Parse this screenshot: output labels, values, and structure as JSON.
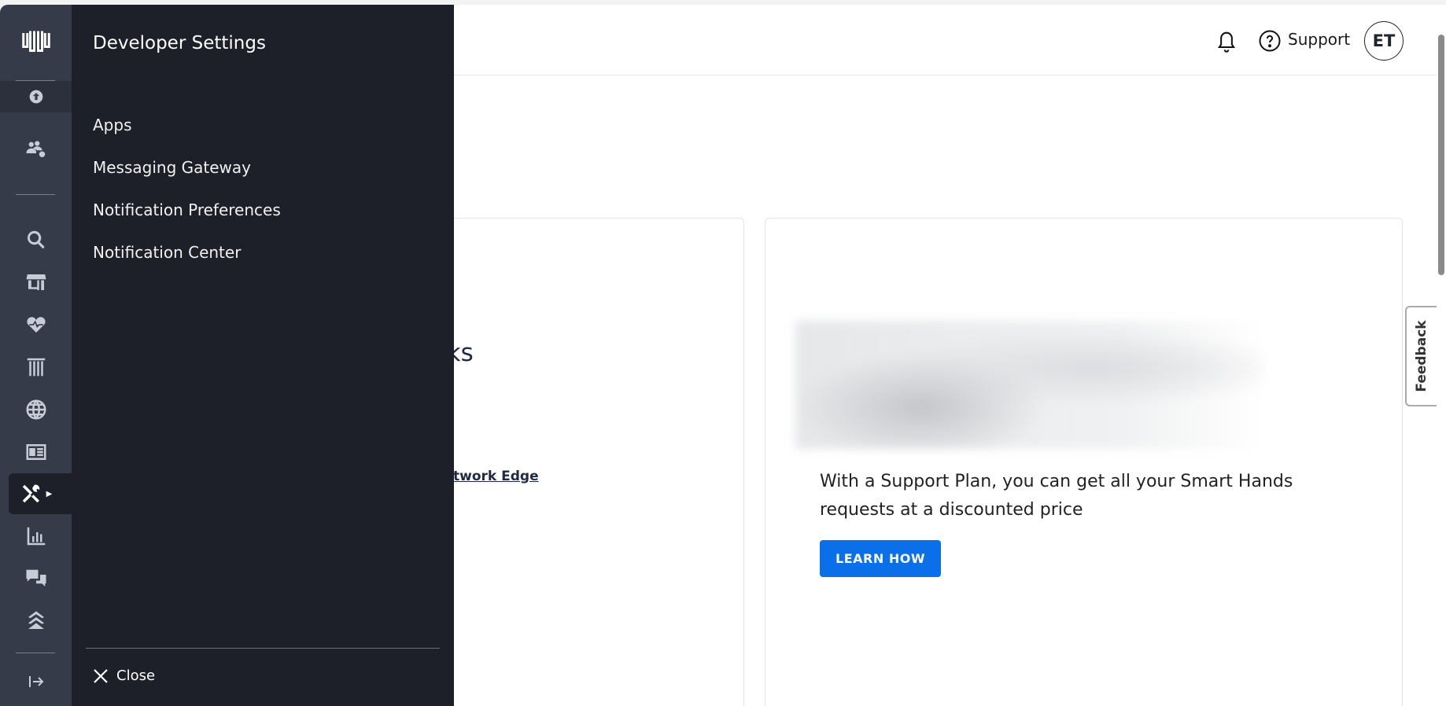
{
  "header": {
    "support_label": "Support",
    "avatar_initials": "ET",
    "icons": [
      "bell-icon",
      "help-circle-icon"
    ]
  },
  "rail": {
    "icons": [
      "logo",
      "upload-icon",
      "users-gear-icon",
      "search-icon",
      "store-icon",
      "heart-pulse-icon",
      "columns-icon",
      "globe-icon",
      "newspaper-icon",
      "tools-icon",
      "bar-chart-icon",
      "chat-icon",
      "layers-icon",
      "expand-icon"
    ],
    "active": "tools-icon"
  },
  "panel": {
    "title": "Developer Settings",
    "items": [
      {
        "label": "Apps"
      },
      {
        "label": "Messaging Gateway"
      },
      {
        "label": "Notification Preferences"
      },
      {
        "label": "Notification Center"
      }
    ],
    "close_label": "Close"
  },
  "main": {
    "card1": {
      "title_fragment": "nks",
      "link_fragment": "twork Edge"
    },
    "card2": {
      "text": "With a Support Plan, you can get all your Smart Hands requests at a discounted price",
      "button_label": "LEARN HOW"
    }
  },
  "feedback_label": "Feedback",
  "colors": {
    "rail": "#363b4a",
    "panel": "#1e2029",
    "primary_button": "#0a6fe8"
  }
}
